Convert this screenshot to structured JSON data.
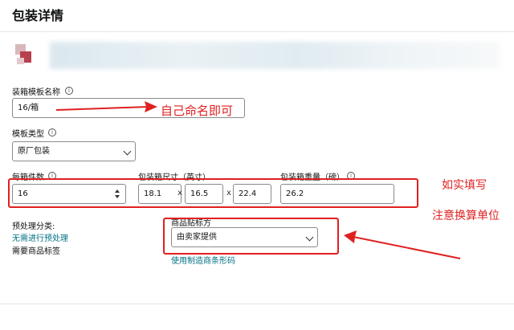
{
  "header": {
    "title": "包装详情"
  },
  "template_name": {
    "label": "装箱模板名称",
    "value": "16/箱"
  },
  "template_type": {
    "label": "模板类型",
    "selected": "原厂包装"
  },
  "units_per_box": {
    "label": "每箱件数",
    "value": "16"
  },
  "box_dimensions": {
    "label": "包装箱尺寸（英寸）",
    "length": "18.1",
    "width": "16.5",
    "height": "22.4",
    "separator": "x"
  },
  "box_weight": {
    "label": "包装箱重量（磅）",
    "value": "26.2"
  },
  "prep": {
    "label": "预处理分类:",
    "link": "无需进行预处理",
    "labeling_required": "需要商品标签"
  },
  "labeling": {
    "label": "商品贴标方",
    "selected": "由卖家提供",
    "link": "使用制造商条形码"
  },
  "annotations": {
    "name_hint": "自己命名即可",
    "fill_truthfully": "如实填写",
    "unit_conversion": "注意换算单位",
    "color": "#e02020"
  },
  "icons": {
    "info": "info-icon",
    "chevron": "chevron-down-icon",
    "stepper": "number-stepper-icon"
  },
  "colors": {
    "link": "#007185",
    "border": "#888c8c"
  }
}
